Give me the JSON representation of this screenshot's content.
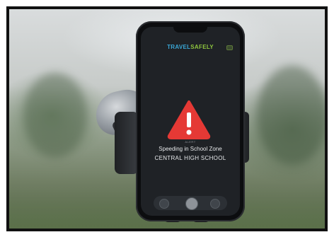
{
  "app": {
    "brand_part1": "TRAVEL",
    "brand_part2": "SAFELY"
  },
  "alert": {
    "label": "ALERT",
    "title": "Speeding in School Zone",
    "subtitle": "CENTRAL HIGH SCHOOL",
    "icon": "warning-triangle-icon"
  },
  "colors": {
    "brand_blue": "#3aa7d6",
    "brand_green": "#8fc63f",
    "alert_red": "#e53935",
    "screen_bg": "#1f2226"
  },
  "nav": {
    "buttons": [
      "nav-left-button",
      "nav-home-button",
      "nav-right-button"
    ]
  }
}
